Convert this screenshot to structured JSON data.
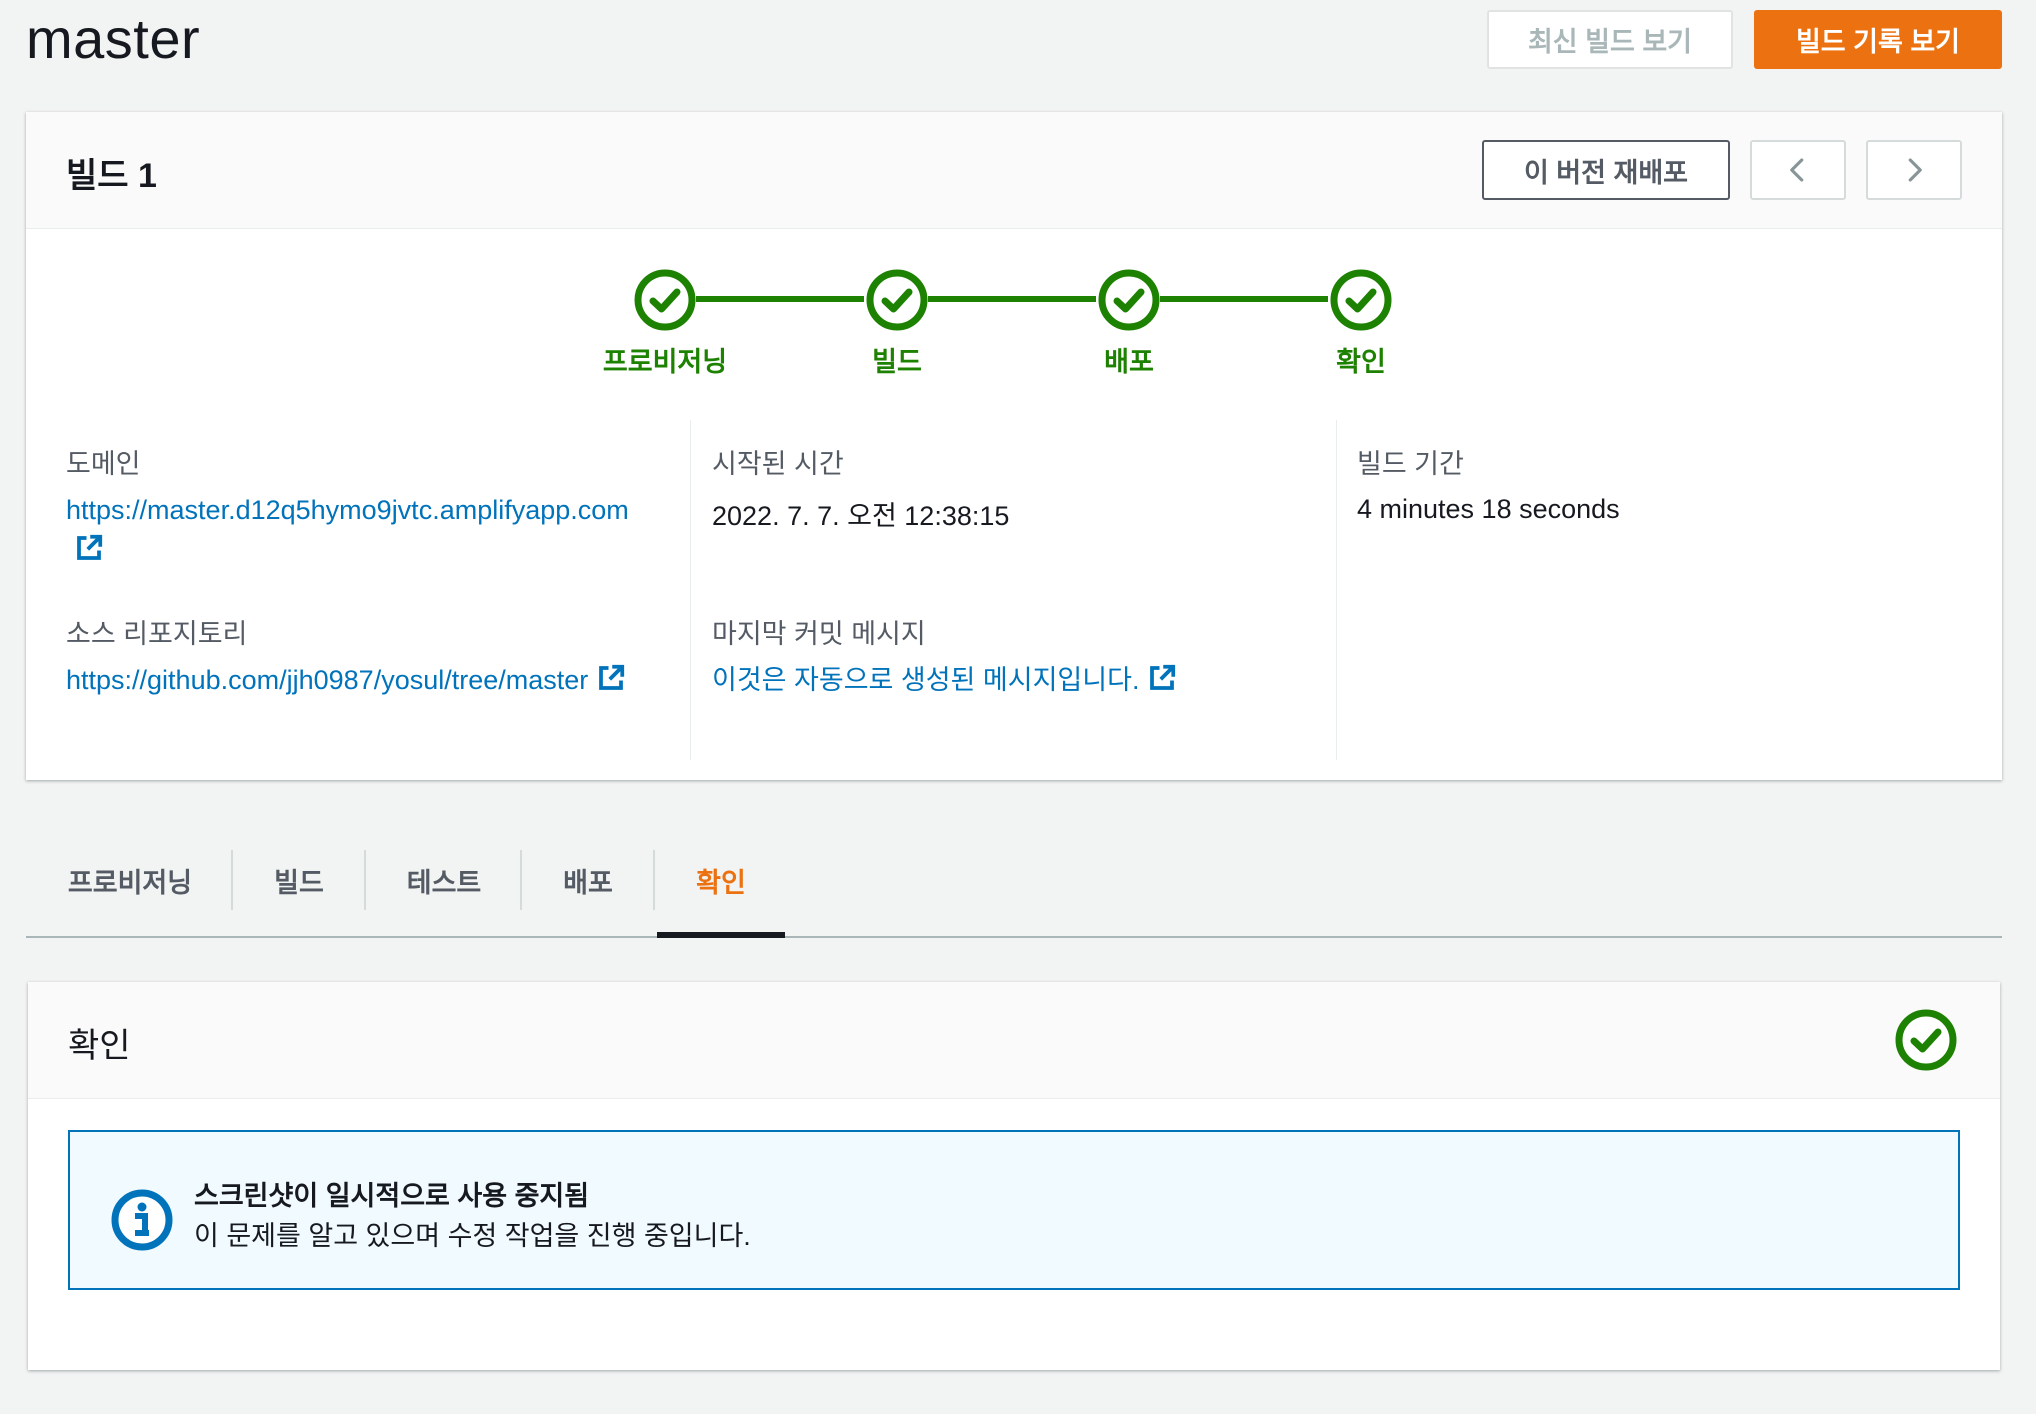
{
  "header": {
    "title": "master",
    "latest_build_button": "최신 빌드 보기",
    "build_history_button": "빌드 기록 보기"
  },
  "build_card": {
    "title": "빌드 1",
    "redeploy_button": "이 버전 재배포",
    "prev_icon": "chevron-left-icon",
    "next_icon": "chevron-right-icon",
    "steps": [
      {
        "label": "프로비저닝",
        "status": "success"
      },
      {
        "label": "빌드",
        "status": "success"
      },
      {
        "label": "배포",
        "status": "success"
      },
      {
        "label": "확인",
        "status": "success"
      }
    ],
    "status_color": "#1d8102",
    "details": {
      "domain_label": "도메인",
      "domain_value": "https://master.d12q5hymo9jvtc.amplifyapp.com",
      "repo_label": "소스 리포지토리",
      "repo_value": "https://github.com/jjh0987/yosul/tree/master",
      "start_label": "시작된 시간",
      "start_value": "2022. 7. 7. 오전 12:38:15",
      "commit_label": "마지막 커밋 메시지",
      "commit_value": "이것은 자동으로 생성된 메시지입니다.",
      "duration_label": "빌드 기간",
      "duration_value": "4 minutes 18 seconds"
    }
  },
  "tabs": [
    {
      "label": "프로비저닝",
      "active": false
    },
    {
      "label": "빌드",
      "active": false
    },
    {
      "label": "테스트",
      "active": false
    },
    {
      "label": "배포",
      "active": false
    },
    {
      "label": "확인",
      "active": true
    }
  ],
  "verify_panel": {
    "title": "확인",
    "status_icon": "check-circle-icon",
    "alert": {
      "icon": "info-icon",
      "title": "스크린샷이 일시적으로 사용 중지됨",
      "body": "이 문제를 알고 있으며 수정 작업을 진행 중입니다."
    }
  },
  "colors": {
    "accent": "#ec7211",
    "link": "#0073bb",
    "success": "#1d8102"
  }
}
